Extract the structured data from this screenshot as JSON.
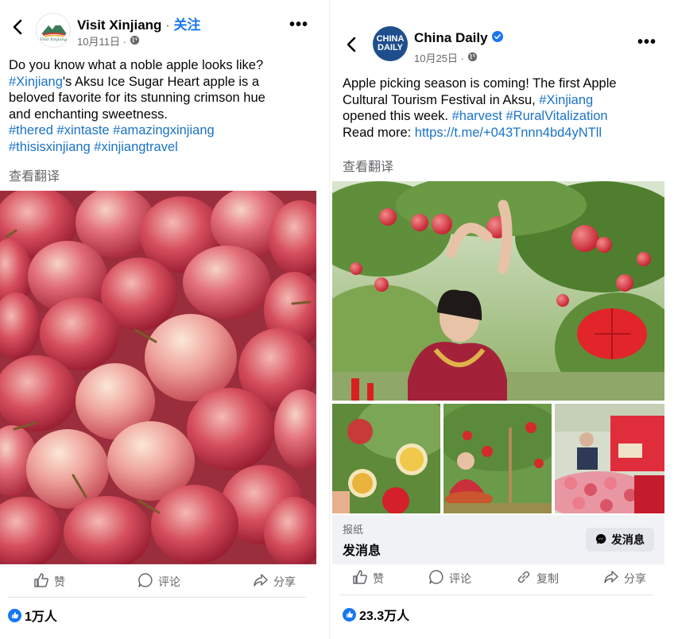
{
  "left_post": {
    "author": "Visit Xinjiang",
    "separator": " · ",
    "follow_label": "关注",
    "date": "10月11日 ·",
    "avatar_text": "Visit Xinjiang",
    "text_line1": "Do you know what a noble apple looks like?",
    "text_tag1": "#Xinjiang",
    "text_line2_rest": "'s Aksu Ice Sugar Heart apple is a",
    "text_line3": "beloved favorite for its stunning crimson hue",
    "text_line4": "and enchanting sweetness.",
    "hashtags_line1": "#thered #xintaste #amazingxinjiang",
    "hashtags_line2": "#thisisxinjiang #xinjiangtravel",
    "translate_label": "查看翻译",
    "actions": {
      "like": "赞",
      "comment": "评论",
      "share": "分享"
    },
    "reaction_count": "1万人"
  },
  "right_post": {
    "author": "China Daily",
    "avatar_line1": "CHINA",
    "avatar_line2": "DAILY",
    "date": "10月25日 ·",
    "text_line1": "Apple picking season is coming! The first Apple",
    "text_line2_pre": "Cultural Tourism Festival in Aksu, ",
    "text_tag_xinjiang": "#Xinjiang",
    "text_line3_pre": "opened this week. ",
    "text_tag_harvest": "#harvest",
    "text_tag_rural": "#RuralVitalization",
    "text_line4_pre": "Read more: ",
    "text_link": "https://t.me/+043Tnnn4bd4yNTll",
    "translate_label": "查看翻译",
    "card_source": "报纸",
    "card_title": "发消息",
    "card_button": "发消息",
    "actions": {
      "like": "赞",
      "comment": "评论",
      "copy": "复制",
      "share": "分享"
    },
    "reaction_count": "23.3万人"
  },
  "colors": {
    "brand_blue": "#1877f2",
    "hashtag_blue": "#1a73c8",
    "meta_gray": "#65676b"
  }
}
